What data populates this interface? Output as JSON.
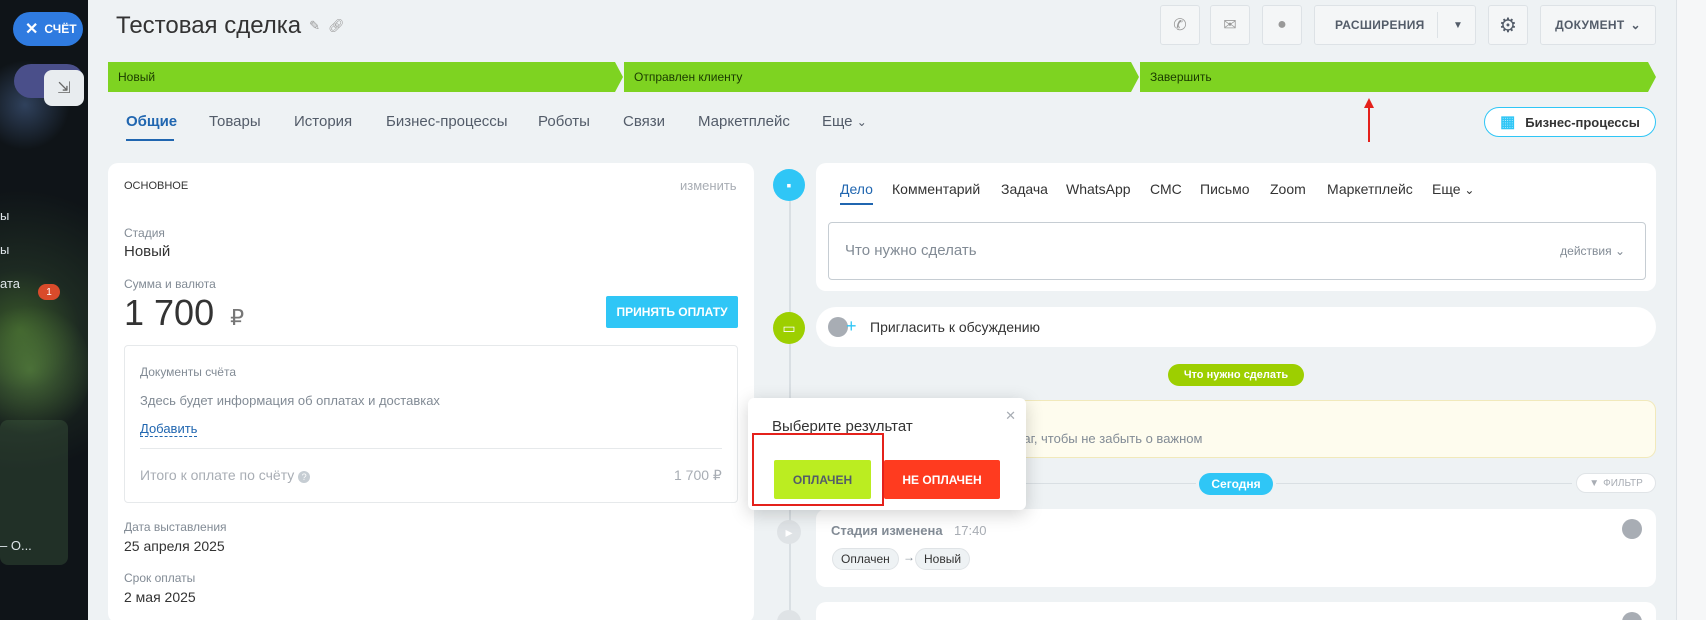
{
  "left_panel": {
    "close_label": "СЧЁТ",
    "partial_texts": [
      "ы",
      "ы",
      "ата",
      "– О..."
    ],
    "badge_count": "1",
    "pill_text": "СД"
  },
  "header": {
    "title": "Тестовая сделка",
    "extensions_label": "РАСШИРЕНИЯ",
    "document_label": "ДОКУМЕНТ"
  },
  "stages": [
    "Новый",
    "Отправлен клиенту",
    "Завершить"
  ],
  "tabs": [
    "Общие",
    "Товары",
    "История",
    "Бизнес-процессы",
    "Роботы",
    "Связи",
    "Маркетплейс",
    "Еще"
  ],
  "bp_button_label": "Бизнес-процессы",
  "main_card": {
    "section_title": "ОСНОВНОЕ",
    "edit_link": "изменить",
    "stage_label": "Стадия",
    "stage_value": "Новый",
    "amount_label": "Сумма и валюта",
    "amount_value": "1 700",
    "currency": "₽",
    "accept_payment_label": "ПРИНЯТЬ ОПЛАТУ",
    "docs_title": "Документы счёта",
    "docs_placeholder": "Здесь будет информация об оплатах и доставках",
    "add_link": "Добавить",
    "total_label": "Итого к оплате по счёту",
    "total_value": "1 700 ₽",
    "issue_date_label": "Дата выставления",
    "issue_date_value": "25 апреля 2025",
    "due_date_label": "Срок оплаты",
    "due_date_value": "2 мая 2025"
  },
  "activity": {
    "tabs": [
      "Дело",
      "Комментарий",
      "Задача",
      "WhatsApp",
      "СМС",
      "Письмо",
      "Zoom",
      "Маркетплейс",
      "Еще"
    ],
    "input_placeholder": "Что нужно сделать",
    "actions_label": "действия",
    "invite_label": "Пригласить к обсуждению",
    "todo_pill": "Что нужно сделать",
    "yellow_text": "шаг, чтобы не забыть о важном",
    "today_pill": "Сегодня",
    "filter_label": "ФИЛЬТР",
    "history_title": "Стадия изменена",
    "history_time": "17:40",
    "history_from": "Оплачен",
    "history_to": "Новый"
  },
  "popup": {
    "title": "Выберите результат",
    "paid_label": "ОПЛАЧЕН",
    "unpaid_label": "НЕ ОПЛАЧЕН"
  },
  "colors": {
    "stage_green": "#7ed321",
    "accent_blue": "#2fc6f6",
    "link_blue": "#2066b0",
    "paid": "#bbed21",
    "unpaid": "#ff3b1f",
    "highlight_red": "#e4211b"
  }
}
